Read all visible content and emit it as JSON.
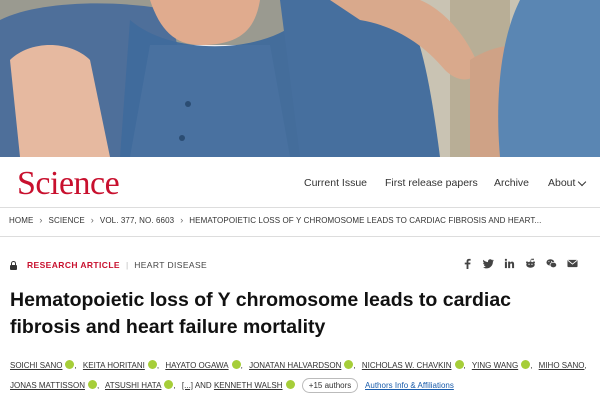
{
  "header": {
    "logo": "Science",
    "nav": {
      "current_issue": "Current Issue",
      "first_release": "First release papers",
      "archive": "Archive",
      "about": "About"
    }
  },
  "breadcrumb": [
    "HOME",
    "SCIENCE",
    "VOL. 377, NO. 6603",
    "HEMATOPOIETIC LOSS OF Y CHROMOSOME LEADS TO CARDIAC FIBROSIS AND HEART..."
  ],
  "article": {
    "type": "RESEARCH ARTICLE",
    "subject": "HEART DISEASE",
    "title_line1": "Hematopoietic loss of Y chromosome leads to cardiac",
    "title_line2": "fibrosis and heart failure mortality",
    "authors_line1": [
      "SOICHI SANO",
      "KEITA HORITANI",
      "HAYATO OGAWA",
      "JONATAN HALVARDSON",
      "NICHOLAS W. CHAVKIN",
      "YING WANG",
      "MIHO SANO"
    ],
    "authors_line2": [
      "JONAS MATTISSON",
      "ATSUSHI HATA"
    ],
    "ellipsis": "[...]",
    "and": "AND",
    "last_author": "KENNETH WALSH",
    "more_authors": "+15 authors",
    "affiliations_link": "Authors Info & Affiliations"
  },
  "share_icons": [
    "facebook-icon",
    "twitter-icon",
    "linkedin-icon",
    "reddit-icon",
    "wechat-icon",
    "email-icon"
  ],
  "colors": {
    "brand_red": "#c8102e",
    "orcid_green": "#a6ce39",
    "link_blue": "#1a5cab"
  }
}
